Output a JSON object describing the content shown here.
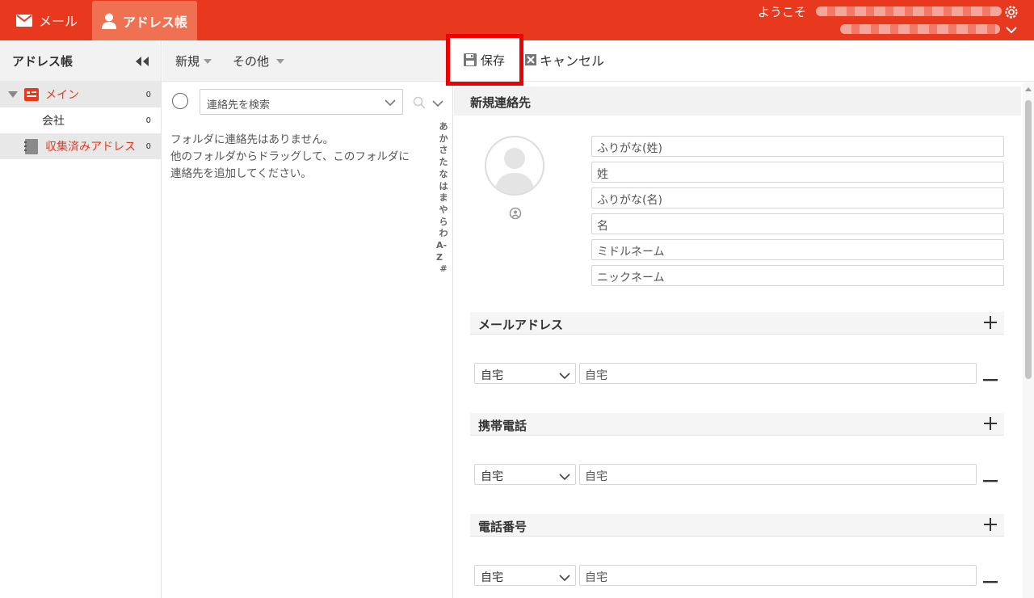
{
  "topbar": {
    "mail_tab": "メール",
    "address_tab": "アドレス帳",
    "welcome_prefix": "ようこそ",
    "icons": {
      "mail": "envelope-icon",
      "address": "person-icon",
      "settings": "gear-icon",
      "menu": "chevron-down-icon"
    }
  },
  "sidebar": {
    "title": "アドレス帳",
    "folders": [
      {
        "label": "メイン",
        "count": "0"
      },
      {
        "label": "会社",
        "count": "0"
      },
      {
        "label": "収集済みアドレス",
        "count": "0"
      }
    ]
  },
  "middle": {
    "toolbar": {
      "new": "新規",
      "other": "その他"
    },
    "search_placeholder": "連絡先を検索",
    "empty_message": [
      "フォルダに連絡先はありません。",
      "他のフォルダからドラッグして、このフォルダに",
      "連絡先を追加してください。"
    ],
    "index": [
      "あ",
      "か",
      "さ",
      "た",
      "な",
      "は",
      "ま",
      "や",
      "ら",
      "わ",
      "A-Z",
      "#"
    ]
  },
  "right": {
    "toolbar": {
      "save": "保存",
      "cancel": "キャンセル"
    },
    "title": "新規連絡先",
    "name_fields": [
      "ふりがな(姓)",
      "姓",
      "ふりがな(名)",
      "名",
      "ミドルネーム",
      "ニックネーム"
    ],
    "sections": [
      {
        "title": "メールアドレス",
        "type": "自宅",
        "placeholder": "自宅"
      },
      {
        "title": "携帯電話",
        "type": "自宅",
        "placeholder": "自宅"
      },
      {
        "title": "電話番号",
        "type": "自宅",
        "placeholder": "自宅"
      }
    ]
  },
  "colors": {
    "brand": "#e8381d",
    "active_tab": "#f07052",
    "highlight": "#ee0000"
  }
}
